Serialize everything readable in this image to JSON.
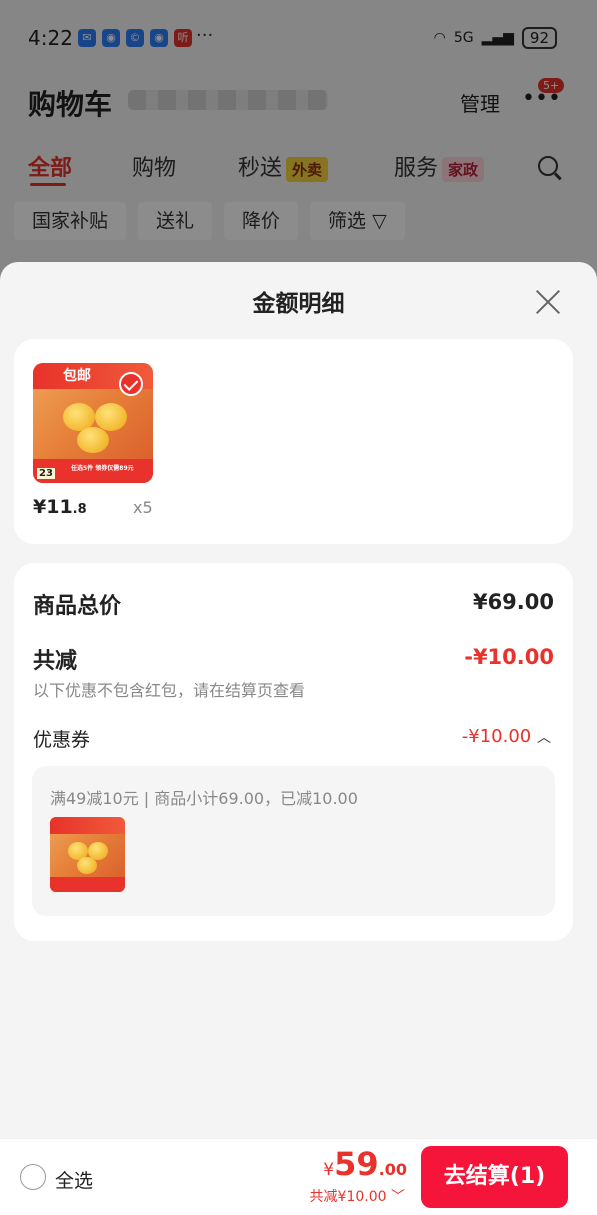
{
  "status_bar": {
    "time": "4:22",
    "network": "5G",
    "battery": "92",
    "more": "···"
  },
  "cart_header": {
    "title": "购物车",
    "manage": "管理",
    "badge": "5+"
  },
  "tabs": [
    {
      "label": "全部"
    },
    {
      "label": "购物"
    },
    {
      "label": "秒送",
      "tag": "外卖"
    },
    {
      "label": "服务",
      "tag": "家政"
    }
  ],
  "filters": [
    "国家补贴",
    "送礼",
    "降价",
    "筛选"
  ],
  "sheet": {
    "title": "金额明细",
    "product": {
      "price_main": "¥11",
      "price_decimal": ".8",
      "quantity": "x5",
      "img_top": "包邮",
      "img_sub": "任选5件 领券仅需89元",
      "img_num": "23"
    },
    "summary": {
      "goods_total_label": "商品总价",
      "goods_total_value": "¥69.00",
      "reduction_label": "共减",
      "reduction_value": "-¥10.00",
      "note": "以下优惠不包含红包，请在结算页查看",
      "coupon_label": "优惠券",
      "coupon_value": "-¥10.00",
      "coupon_detail": "满49减10元 | 商品小计69.00，已减10.00"
    }
  },
  "bottom_bar": {
    "select_all": "全选",
    "currency": "¥",
    "total_int": "59",
    "total_dec": ".00",
    "discount": "共减¥10.00",
    "checkout": "去结算(1)"
  },
  "colors": {
    "accent": "#e8322b",
    "checkout": "#f5153a",
    "background": "#f4f4f4"
  }
}
